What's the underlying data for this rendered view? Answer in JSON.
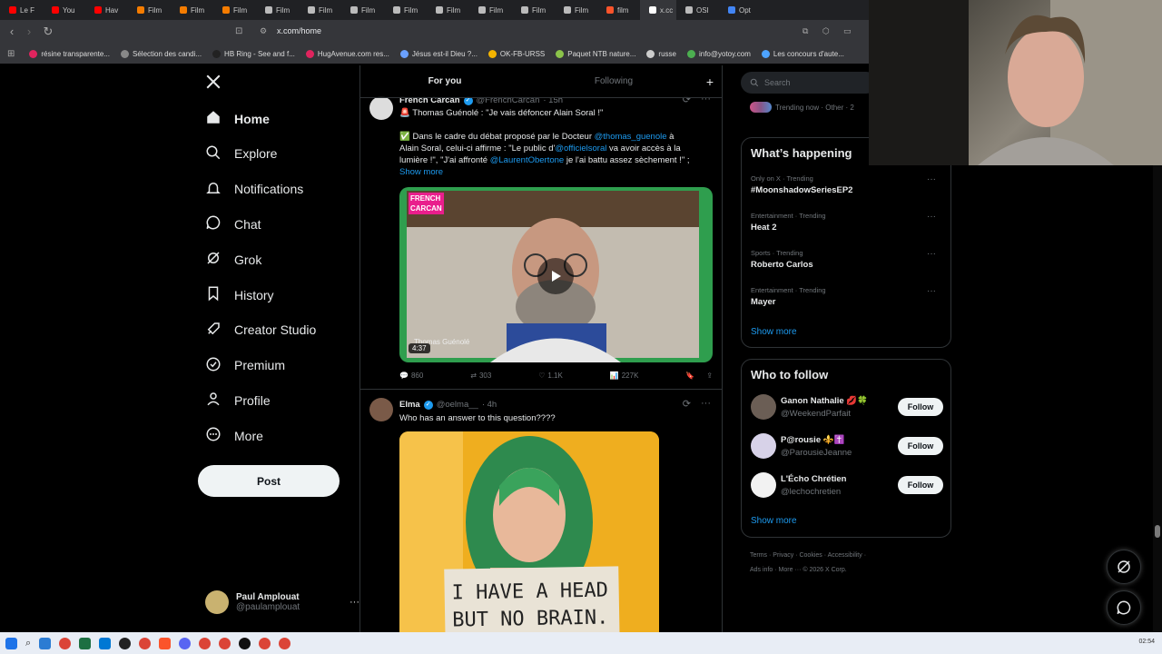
{
  "browser": {
    "tabs": [
      {
        "label": "Le F",
        "icon": "youtube-icon"
      },
      {
        "label": "You",
        "icon": "youtube-icon"
      },
      {
        "label": "Hav",
        "icon": "youtube-icon"
      },
      {
        "label": "Film",
        "icon": "play-icon"
      },
      {
        "label": "Film",
        "icon": "play-icon"
      },
      {
        "label": "Film",
        "icon": "play-icon"
      },
      {
        "label": "Film",
        "icon": "globe-icon"
      },
      {
        "label": "Film",
        "icon": "globe-icon"
      },
      {
        "label": "Film",
        "icon": "globe-icon"
      },
      {
        "label": "Film",
        "icon": "globe-icon"
      },
      {
        "label": "Film",
        "icon": "globe-icon"
      },
      {
        "label": "Film",
        "icon": "globe-icon"
      },
      {
        "label": "Film",
        "icon": "globe-icon"
      },
      {
        "label": "Film",
        "icon": "globe-icon"
      },
      {
        "label": "film",
        "icon": "brave-icon"
      },
      {
        "label": "x.cc",
        "icon": "x-icon"
      },
      {
        "label": "OSI",
        "icon": "globe-icon"
      },
      {
        "label": "Opt",
        "icon": "chevron-icon"
      }
    ],
    "url": "x.com/home",
    "bookmarks": [
      {
        "label": "résine transparente...",
        "color": "#e0245e"
      },
      {
        "label": "Sélection des candi...",
        "color": "#888888"
      },
      {
        "label": "HB Ring - See and f...",
        "color": "#222222"
      },
      {
        "label": "HugAvenue.com res...",
        "color": "#e0245e"
      },
      {
        "label": "Jésus est-il Dieu ?...",
        "color": "#6aa0ff"
      },
      {
        "label": "OK-FB-URSS",
        "color": "#f4b400"
      },
      {
        "label": "Paquet NTB nature...",
        "color": "#8bc34a"
      },
      {
        "label": "russe",
        "color": "#cccccc"
      },
      {
        "label": "info@yotoy.com",
        "color": "#4caf50"
      },
      {
        "label": "Les concours d'aute...",
        "color": "#4da3ff"
      }
    ]
  },
  "nav": {
    "items": [
      {
        "label": "Home",
        "icon": "home-icon"
      },
      {
        "label": "Explore",
        "icon": "search-icon"
      },
      {
        "label": "Notifications",
        "icon": "bell-icon"
      },
      {
        "label": "Chat",
        "icon": "chat-icon"
      },
      {
        "label": "Grok",
        "icon": "grok-icon"
      },
      {
        "label": "History",
        "icon": "bookmark-icon"
      },
      {
        "label": "Creator Studio",
        "icon": "rocket-icon"
      },
      {
        "label": "Premium",
        "icon": "verified-icon"
      },
      {
        "label": "Profile",
        "icon": "person-icon"
      },
      {
        "label": "More",
        "icon": "more-circle-icon"
      }
    ],
    "post_label": "Post",
    "account": {
      "name": "Paul Amplouat",
      "handle": "@paulamplouat"
    }
  },
  "feed": {
    "tabs": [
      "For you",
      "Following"
    ],
    "posts": [
      {
        "name": "French Carcan",
        "handle": "@FrenchCarcan",
        "time": "· 15h",
        "lines": [
          "🚨 Thomas Guénolé : \"Je vais défoncer Alain Soral !\"",
          "✅ Dans le cadre du débat proposé par le Docteur",
          "Alain Soral, celui-ci affirme : \"Le public d'",
          "lumière !\", \"J'ai affronté",
          "Show more"
        ],
        "mentions": [
          "@thomas_guenole",
          "à",
          "@officielsoral",
          "va avoir accès à la",
          "@LaurentObertone",
          "je l'ai battu assez sèchement !\" ;"
        ],
        "video": {
          "badge": [
            "FRENCH",
            "CARCAN"
          ],
          "caption": "Thomas Guénolé",
          "duration": "4:37"
        },
        "stats": {
          "replies": "860",
          "reposts": "303",
          "likes": "1.1K",
          "views": "227K"
        }
      },
      {
        "name": "Elma",
        "handle": "@oelma__",
        "time": "· 4h",
        "text": "Who has an answer to this question????",
        "sign": [
          "I HAVE A HEAD",
          "BUT NO BRAIN."
        ]
      }
    ]
  },
  "right": {
    "search_placeholder": "Search",
    "trending_strip": "Trending now · Other · 2",
    "whats_happening": {
      "title": "What’s happening",
      "trends": [
        {
          "meta": "Only on X · Trending",
          "name": "#MoonshadowSeriesEP2"
        },
        {
          "meta": "Entertainment · Trending",
          "name": "Heat 2"
        },
        {
          "meta": "Sports · Trending",
          "name": "Roberto Carlos"
        },
        {
          "meta": "Entertainment · Trending",
          "name": "Mayer"
        }
      ],
      "show_more": "Show more"
    },
    "who_to_follow": {
      "title": "Who to follow",
      "accounts": [
        {
          "name": "Ganon Nathalie 💋🍀",
          "handle": "@WeekendParfait",
          "avatar_color": "#6b5e55"
        },
        {
          "name": "P@rousie ⚜️✝️",
          "handle": "@ParousieJeanne",
          "avatar_color": "#d7d2e8"
        },
        {
          "name": "L'Écho Chrétien",
          "handle": "@lechochretien",
          "avatar_color": "#f2f2f2"
        }
      ],
      "follow_label": "Follow",
      "show_more": "Show more"
    },
    "footer": {
      "links": [
        "Terms",
        "Privacy",
        "Cookies",
        "Accessibility",
        "Ads info",
        "More ···"
      ],
      "copyright": "© 2026 X Corp."
    }
  },
  "taskbar": {
    "clock": "02:54"
  }
}
